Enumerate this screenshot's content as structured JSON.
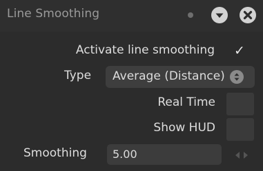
{
  "panel": {
    "title": "Line Smoothing",
    "icons": {
      "status_dot": "dot-icon",
      "collapse": "chevron-down-icon",
      "close": "close-icon"
    }
  },
  "activate": {
    "label": "Activate line smoothing",
    "checked": true,
    "check_glyph": "✓"
  },
  "type": {
    "label": "Type",
    "selected": "Average (Distance)"
  },
  "real_time": {
    "label": "Real Time",
    "checked": false
  },
  "show_hud": {
    "label": "Show HUD",
    "checked": false
  },
  "smoothing": {
    "label": "Smoothing",
    "value": "5.00"
  },
  "colors": {
    "panel_bg": "#2c2c2c",
    "field_bg": "#3c3c3c",
    "title_text": "#9a9a9a",
    "label_text": "#dedede",
    "button_fill": "#d2d2d2"
  }
}
